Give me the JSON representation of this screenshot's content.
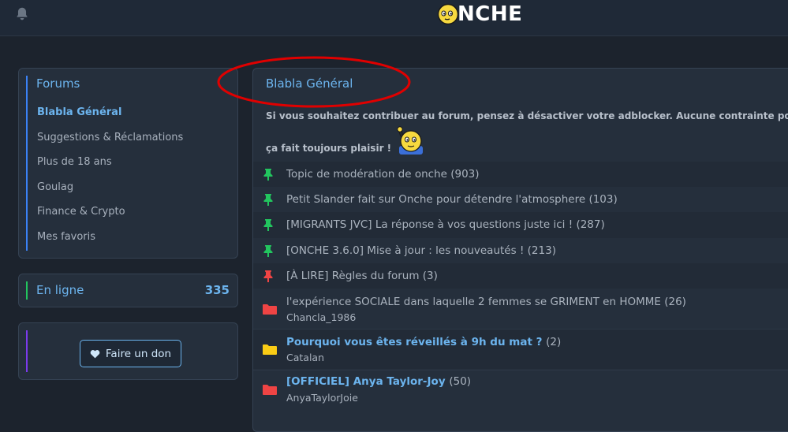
{
  "header": {
    "logo_text": "NCHE",
    "bell_icon": "bell-icon"
  },
  "sidebar": {
    "forums_title": "Forums",
    "items": [
      {
        "label": "Blabla Général",
        "active": true
      },
      {
        "label": "Suggestions & Réclamations"
      },
      {
        "label": "Plus de 18 ans"
      },
      {
        "label": "Goulag"
      },
      {
        "label": "Finance & Crypto"
      },
      {
        "label": "Mes favoris"
      }
    ],
    "online_label": "En ligne",
    "online_count": "335",
    "donate_label": "Faire un don"
  },
  "main": {
    "title": "Blabla Général",
    "notice_line1": "Si vous souhaitez contribuer au forum, pensez à désactiver votre adblocker. Aucune contrainte pour ceu",
    "notice_line2": "ça fait toujours plaisir !",
    "pinned": [
      {
        "title": "Topic de modération de onche",
        "count": "(903)",
        "pin_color": "#22c55e"
      },
      {
        "title": "Petit Slander fait sur Onche pour détendre l'atmosphere",
        "count": "(103)",
        "pin_color": "#22c55e"
      },
      {
        "title": "[MIGRANTS JVC] La réponse à vos questions juste ici !",
        "count": "(287)",
        "pin_color": "#22c55e"
      },
      {
        "title": "[ONCHE 3.6.0] Mise à jour : les nouveautés !",
        "count": "(213)",
        "pin_color": "#22c55e"
      },
      {
        "title": "[À LIRE] Règles du forum",
        "count": "(3)",
        "pin_color": "#ef4444"
      }
    ],
    "topics": [
      {
        "title": "l'expérience SOCIALE dans laquelle 2 femmes se GRIMENT en HOMME",
        "count": "(26)",
        "author": "Chancla_1986",
        "folder_color": "#ef4444",
        "bold": false
      },
      {
        "title": "Pourquoi vous êtes réveillés à 9h du mat ?",
        "count": "(2)",
        "author": "Catalan",
        "folder_color": "#facc15",
        "bold": true
      },
      {
        "title": "[OFFICIEL] Anya Taylor-Joy",
        "count": "(50)",
        "author": "AnyaTaylorJoie",
        "folder_color": "#ef4444",
        "bold": true
      }
    ]
  },
  "colors": {
    "accent": "#6cb4ee",
    "annotation_ellipse": "#e00000"
  }
}
